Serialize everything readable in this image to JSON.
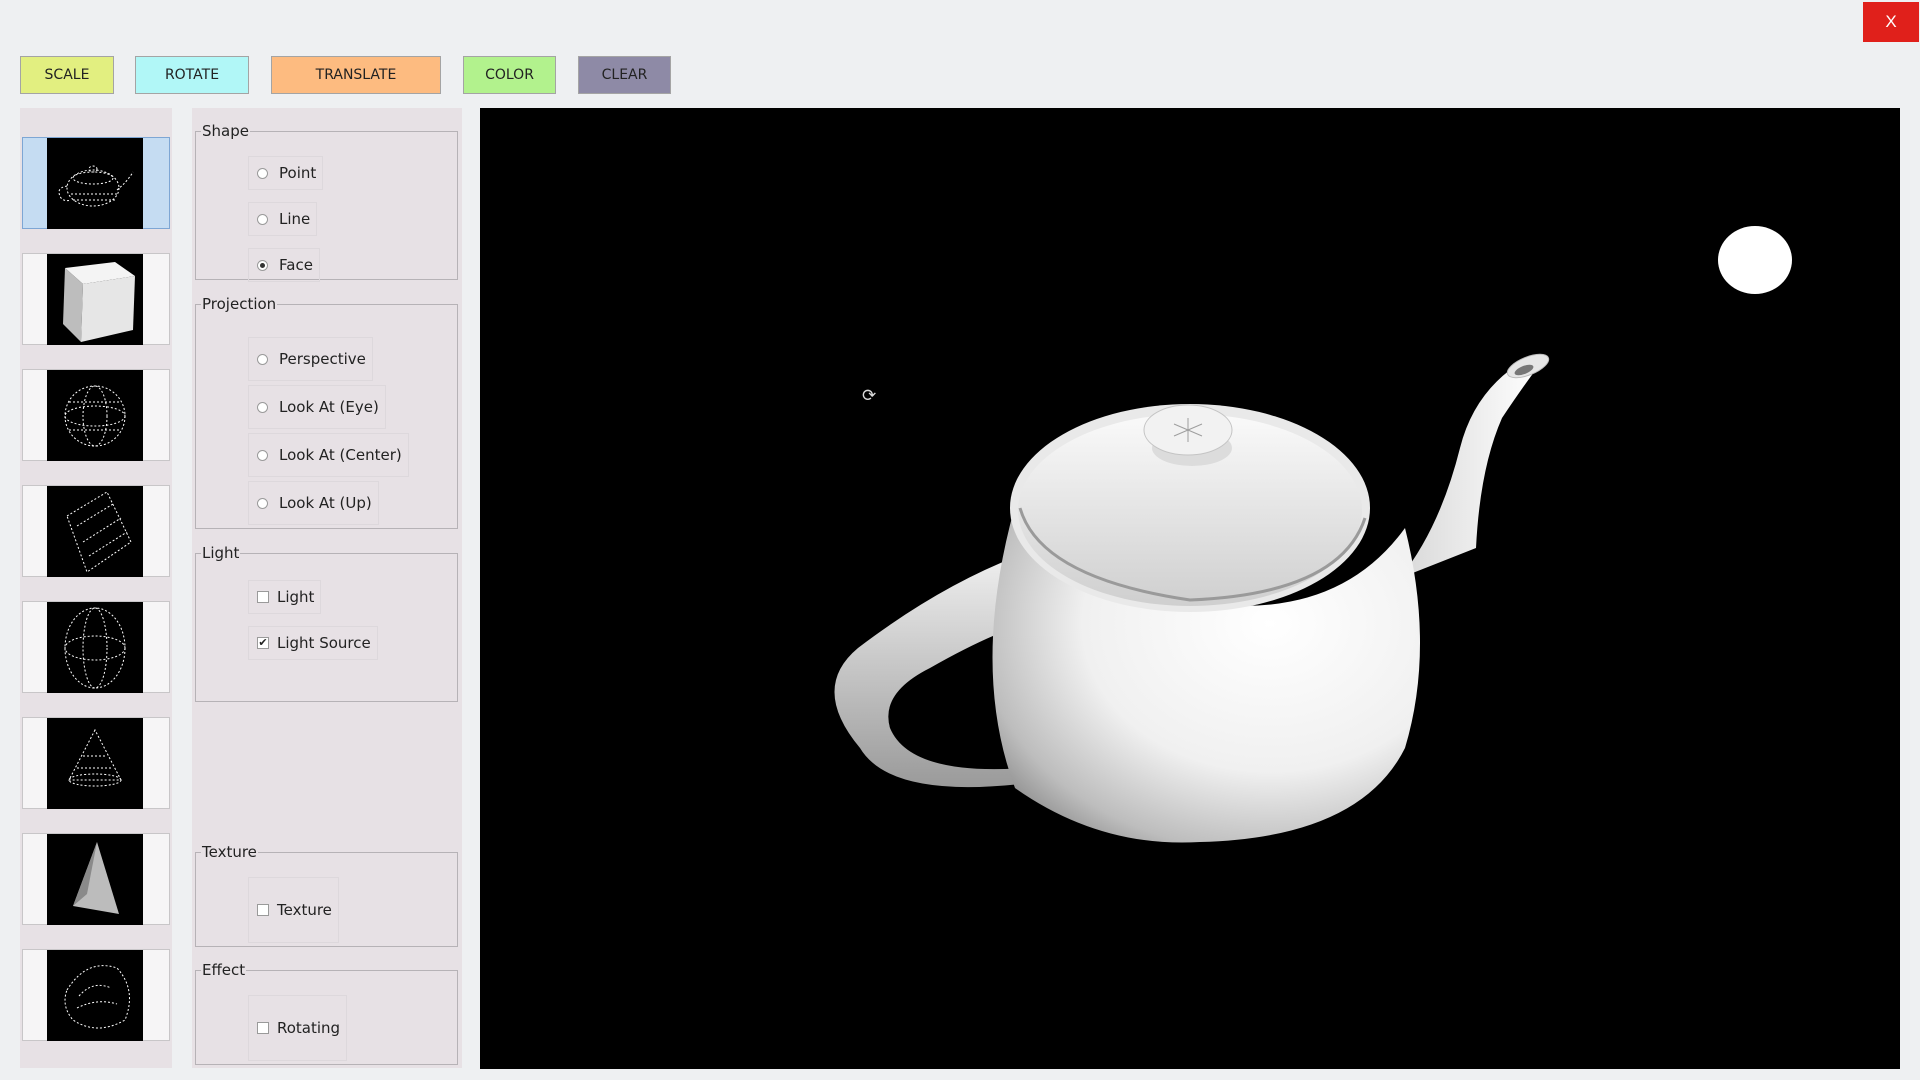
{
  "window": {
    "close_label": "X"
  },
  "toolbar": {
    "scale": {
      "label": "SCALE",
      "color": "#e2ef80"
    },
    "rotate": {
      "label": "ROTATE",
      "color": "#b1f7f7"
    },
    "translate": {
      "label": "TRANSLATE",
      "color": "#fdbb80"
    },
    "color": {
      "label": "COLOR",
      "color": "#b2f28d"
    },
    "clear": {
      "label": "CLEAR",
      "color": "#8e8aa6"
    }
  },
  "thumbnails": [
    {
      "icon": "teapot-wireframe-icon",
      "selected": true
    },
    {
      "icon": "cube-solid-icon",
      "selected": false
    },
    {
      "icon": "sphere-wireframe-icon",
      "selected": false
    },
    {
      "icon": "cylinder-wireframe-icon",
      "selected": false
    },
    {
      "icon": "ellipsoid-wireframe-icon",
      "selected": false
    },
    {
      "icon": "cone-wireframe-icon",
      "selected": false
    },
    {
      "icon": "pyramid-solid-icon",
      "selected": false
    },
    {
      "icon": "torus-wireframe-icon",
      "selected": false
    }
  ],
  "shape": {
    "title": "Shape",
    "options": [
      {
        "label": "Point",
        "selected": false
      },
      {
        "label": "Line",
        "selected": false
      },
      {
        "label": "Face",
        "selected": true
      }
    ]
  },
  "projection": {
    "title": "Projection",
    "options": [
      {
        "label": "Perspective",
        "selected": false
      },
      {
        "label": "Look At (Eye)",
        "selected": false
      },
      {
        "label": "Look At (Center)",
        "selected": false
      },
      {
        "label": "Look At (Up)",
        "selected": false
      }
    ]
  },
  "light": {
    "title": "Light",
    "options": [
      {
        "label": "Light",
        "checked": false
      },
      {
        "label": "Light Source",
        "checked": true
      }
    ]
  },
  "texture": {
    "title": "Texture",
    "options": [
      {
        "label": "Texture",
        "checked": false
      }
    ]
  },
  "effect": {
    "title": "Effect",
    "options": [
      {
        "label": "Rotating",
        "checked": false
      }
    ]
  },
  "viewport": {
    "background": "#000000",
    "object": "teapot",
    "cursor_icon": "rotate-cursor-icon"
  }
}
